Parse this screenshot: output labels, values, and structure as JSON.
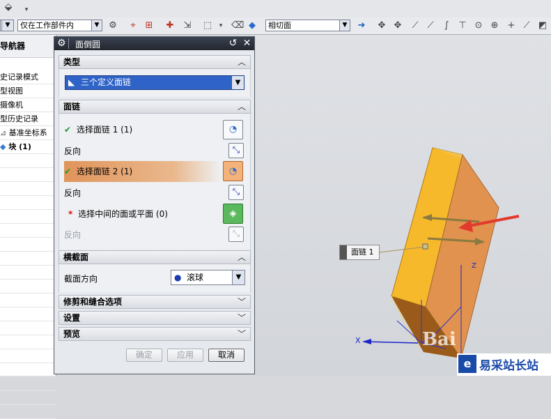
{
  "toolbar": {
    "filter_value": "仅在工作部件内",
    "section_value": "相切面"
  },
  "navigator": {
    "title": "导航器",
    "items": [
      "史记录模式",
      "型视图",
      "摄像机",
      "型历史记录",
      "基准坐标系",
      "块 (1)"
    ]
  },
  "dialog": {
    "title": "面倒圆",
    "type_section": "类型",
    "type_value": "三个定义面链",
    "facechain_section": "面链",
    "select_chain1": "选择面链 1 (1)",
    "reverse1": "反向",
    "select_chain2": "选择面链 2 (1)",
    "reverse2": "反向",
    "select_middle": "选择中间的面或平面 (0)",
    "reverse3": "反向",
    "cross_section": "横截面",
    "cross_dir_label": "截面方向",
    "cross_dir_value": "滚球",
    "trim_section": "修剪和缝合选项",
    "settings_section": "设置",
    "preview_section": "预览",
    "ok": "确定",
    "apply": "应用",
    "cancel": "取消"
  },
  "viewport": {
    "chain_label": "面链 1",
    "axis_x": "X",
    "axis_z": "Z",
    "watermark": "Bai",
    "logo_text": "易采站长站"
  },
  "colors": {
    "block_front": "#f7b52a",
    "block_side": "#e2924a",
    "block_top": "#f5c03c",
    "arrow_red": "#e23b2e",
    "dialog_title": "#2a303c"
  }
}
